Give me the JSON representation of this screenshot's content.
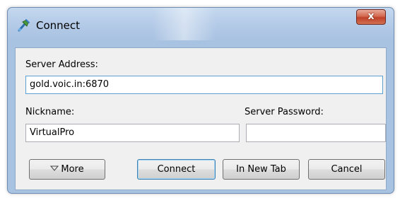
{
  "window": {
    "title": "Connect",
    "close_glyph": "x",
    "icon": "connect-app-icon"
  },
  "form": {
    "server_address_label": "Server Address:",
    "server_address_value": "gold.voic.in:6870",
    "nickname_label": "Nickname:",
    "nickname_value": "VirtualPro",
    "server_password_label": "Server Password:",
    "server_password_value": ""
  },
  "buttons": {
    "more_label": "More",
    "more_icon": "triangle-down-icon",
    "connect_label": "Connect",
    "new_tab_label": "In New Tab",
    "cancel_label": "Cancel"
  }
}
